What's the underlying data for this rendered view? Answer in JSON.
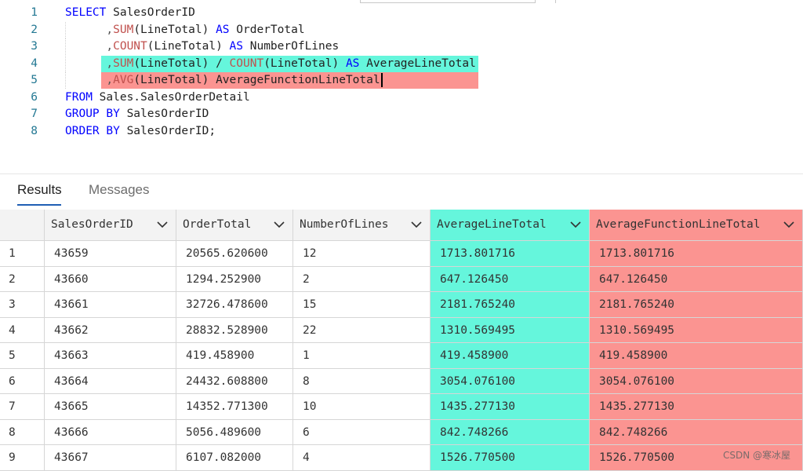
{
  "editor": {
    "lines": [
      {
        "num": "1",
        "parts": [
          {
            "t": "SELECT",
            "c": "kw"
          },
          {
            "t": " SalesOrderID",
            "c": ""
          }
        ]
      },
      {
        "num": "2",
        "parts": [
          {
            "t": "      ,",
            "c": "punc"
          },
          {
            "t": "SUM",
            "c": "fn"
          },
          {
            "t": "(LineTotal) ",
            "c": ""
          },
          {
            "t": "AS",
            "c": "kw"
          },
          {
            "t": " OrderTotal",
            "c": ""
          }
        ]
      },
      {
        "num": "3",
        "parts": [
          {
            "t": "      ,",
            "c": "punc"
          },
          {
            "t": "COUNT",
            "c": "fn"
          },
          {
            "t": "(LineTotal) ",
            "c": ""
          },
          {
            "t": "AS",
            "c": "kw"
          },
          {
            "t": " NumberOfLines",
            "c": ""
          }
        ]
      },
      {
        "num": "4",
        "parts": [
          {
            "t": "      ,",
            "c": "punc"
          },
          {
            "t": "SUM",
            "c": "fn"
          },
          {
            "t": "(LineTotal) / ",
            "c": ""
          },
          {
            "t": "COUNT",
            "c": "fn"
          },
          {
            "t": "(LineTotal) ",
            "c": ""
          },
          {
            "t": "AS",
            "c": "kw"
          },
          {
            "t": " AverageLineTotal",
            "c": ""
          }
        ]
      },
      {
        "num": "5",
        "parts": [
          {
            "t": "      ,",
            "c": "punc"
          },
          {
            "t": "AVG",
            "c": "fn"
          },
          {
            "t": "(LineTotal) AverageFunctionLineTotal",
            "c": ""
          }
        ]
      },
      {
        "num": "6",
        "parts": [
          {
            "t": "FROM",
            "c": "kw"
          },
          {
            "t": " Sales.SalesOrderDetail",
            "c": ""
          }
        ]
      },
      {
        "num": "7",
        "parts": [
          {
            "t": "GROUP BY",
            "c": "kw"
          },
          {
            "t": " SalesOrderID",
            "c": ""
          }
        ]
      },
      {
        "num": "8",
        "parts": [
          {
            "t": "ORDER BY",
            "c": "kw"
          },
          {
            "t": " SalesOrderID;",
            "c": ""
          }
        ]
      }
    ]
  },
  "tabs": {
    "results": "Results",
    "messages": "Messages"
  },
  "grid": {
    "columns": [
      "",
      "SalesOrderID",
      "OrderTotal",
      "NumberOfLines",
      "AverageLineTotal",
      "AverageFunctionLineTotal"
    ],
    "rows": [
      [
        "1",
        "43659",
        "20565.620600",
        "12",
        "1713.801716",
        "1713.801716"
      ],
      [
        "2",
        "43660",
        "1294.252900",
        "2",
        "647.126450",
        "647.126450"
      ],
      [
        "3",
        "43661",
        "32726.478600",
        "15",
        "2181.765240",
        "2181.765240"
      ],
      [
        "4",
        "43662",
        "28832.528900",
        "22",
        "1310.569495",
        "1310.569495"
      ],
      [
        "5",
        "43663",
        "419.458900",
        "1",
        "419.458900",
        "419.458900"
      ],
      [
        "6",
        "43664",
        "24432.608800",
        "8",
        "3054.076100",
        "3054.076100"
      ],
      [
        "7",
        "43665",
        "14352.771300",
        "10",
        "1435.277130",
        "1435.277130"
      ],
      [
        "8",
        "43666",
        "5056.489600",
        "6",
        "842.748266",
        "842.748266"
      ],
      [
        "9",
        "43667",
        "6107.082000",
        "4",
        "1526.770500",
        "1526.770500"
      ]
    ]
  },
  "highlight_colors": {
    "teal": "#65f6dc",
    "red": "#fb9491"
  },
  "icons": {
    "column_menu": "chevron-down-icon"
  },
  "watermark": "CSDN @寒冰屋"
}
